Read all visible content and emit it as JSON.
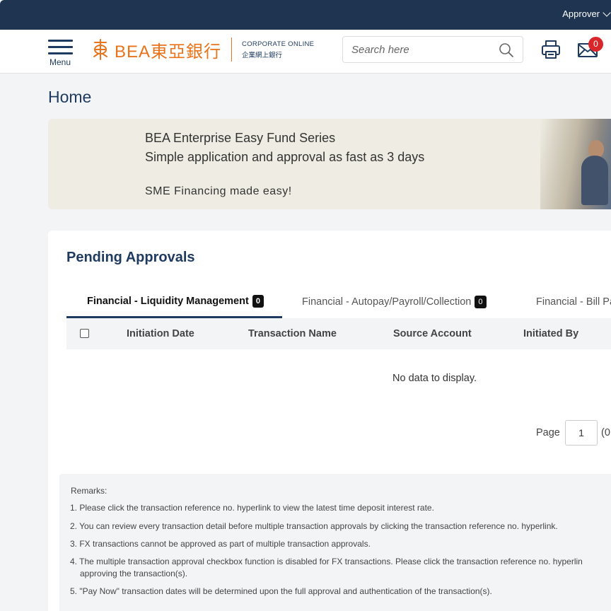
{
  "topbar": {
    "role": "Approver"
  },
  "header": {
    "menu_label": "Menu",
    "logo_text": "BEA東亞銀行",
    "logo_sub_en": "CORPORATE ONLINE",
    "logo_sub_zh": "企業網上銀行",
    "search_placeholder": "Search here",
    "mail_count": "0"
  },
  "page_title": "Home",
  "banner": {
    "line1": "BEA Enterprise Easy Fund Series",
    "line2": "Simple application and approval as fast as 3 days",
    "line3": "SME Financing made easy!"
  },
  "pending": {
    "title": "Pending Approvals",
    "tabs": [
      {
        "label": "Financial - Liquidity Management",
        "count": "0"
      },
      {
        "label": "Financial - Autopay/Payroll/Collection",
        "count": "0"
      },
      {
        "label": "Financial - Bill Pa"
      }
    ],
    "columns": [
      "Initiation Date",
      "Transaction Name",
      "Source Account",
      "Initiated By"
    ],
    "empty_message": "No data to display.",
    "pager": {
      "label": "Page",
      "current": "1",
      "total": "(0"
    }
  },
  "remarks": {
    "title": "Remarks:",
    "items": [
      "1. Please click the transaction reference no. hyperlink to view the latest time deposit interest rate.",
      "2. You can review every transaction detail before multiple transaction approvals by clicking the transaction reference no. hyperlink.",
      "3. FX transactions cannot be approved as part of multiple transaction approvals.",
      "4. The multiple transaction approval checkbox function is disabled for FX transactions. Please click the transaction reference no. hyperlin",
      "approving the transaction(s).",
      "5. \"Pay Now\" transaction dates will be determined upon the full approval and authentication of the transaction(s)."
    ]
  },
  "colors": {
    "navy": "#1e3450",
    "accent_orange": "#e8731a",
    "badge_red": "#d9262b"
  }
}
